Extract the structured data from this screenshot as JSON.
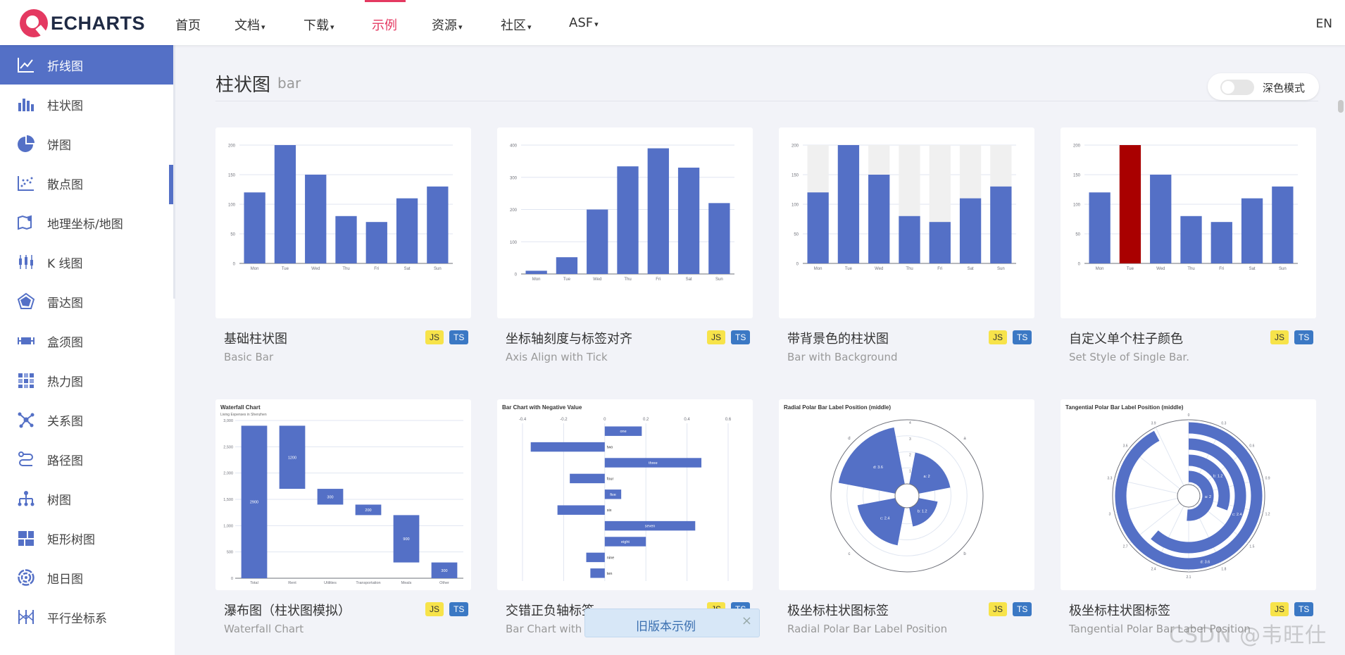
{
  "nav": {
    "logo_text": "ECHARTS",
    "items": [
      {
        "label": "首页",
        "caret": ""
      },
      {
        "label": "文档",
        "caret": "▾"
      },
      {
        "label": "下载",
        "caret": "▾"
      },
      {
        "label": "示例",
        "caret": ""
      },
      {
        "label": "资源",
        "caret": "▾"
      },
      {
        "label": "社区",
        "caret": "▾"
      },
      {
        "label": "ASF",
        "caret": "▾"
      }
    ],
    "active": "示例",
    "lang": "EN"
  },
  "sidebar": {
    "items": [
      {
        "label": "折线图",
        "icon": "line-chart-icon",
        "active": true
      },
      {
        "label": "柱状图",
        "icon": "bar-chart-icon"
      },
      {
        "label": "饼图",
        "icon": "pie-chart-icon"
      },
      {
        "label": "散点图",
        "icon": "scatter-chart-icon"
      },
      {
        "label": "地理坐标/地图",
        "icon": "map-icon"
      },
      {
        "label": "K 线图",
        "icon": "candlestick-icon"
      },
      {
        "label": "雷达图",
        "icon": "radar-icon"
      },
      {
        "label": "盒须图",
        "icon": "boxplot-icon"
      },
      {
        "label": "热力图",
        "icon": "heatmap-icon"
      },
      {
        "label": "关系图",
        "icon": "graph-icon"
      },
      {
        "label": "路径图",
        "icon": "lines-icon"
      },
      {
        "label": "树图",
        "icon": "tree-icon"
      },
      {
        "label": "矩形树图",
        "icon": "treemap-icon"
      },
      {
        "label": "旭日图",
        "icon": "sunburst-icon"
      },
      {
        "label": "平行坐标系",
        "icon": "parallel-icon"
      }
    ]
  },
  "header": {
    "title": "柱状图",
    "subtitle": "bar",
    "dark_mode_label": "深色模式",
    "dark_mode_on": false
  },
  "cards": [
    {
      "title": "基础柱状图",
      "subtitle": "Basic Bar",
      "js": "JS",
      "ts": "TS"
    },
    {
      "title": "坐标轴刻度与标签对齐",
      "subtitle": "Axis Align with Tick",
      "js": "JS",
      "ts": "TS"
    },
    {
      "title": "带背景色的柱状图",
      "subtitle": "Bar with Background",
      "js": "JS",
      "ts": "TS"
    },
    {
      "title": "自定义单个柱子颜色",
      "subtitle": "Set Style of Single Bar.",
      "js": "JS",
      "ts": "TS"
    },
    {
      "title": "瀑布图（柱状图模拟）",
      "subtitle": "Waterfall Chart",
      "js": "JS",
      "ts": "TS"
    },
    {
      "title": "交错正负轴标签",
      "subtitle": "Bar Chart with Negative Value",
      "js": "JS",
      "ts": "TS"
    },
    {
      "title": "极坐标柱状图标签",
      "subtitle": "Radial Polar Bar Label Position",
      "js": "JS",
      "ts": "TS"
    },
    {
      "title": "极坐标柱状图标签",
      "subtitle": "Tangential Polar Bar Label Position",
      "js": "JS",
      "ts": "TS"
    }
  ],
  "toast": {
    "label": "旧版本示例",
    "close": "×"
  },
  "watermark": "CSDN @韦旺仕",
  "colors": {
    "accent": "#5470c6",
    "brand": "#e43961",
    "highlight": "#a90000"
  },
  "chart_data": [
    {
      "type": "bar",
      "categories": [
        "Mon",
        "Tue",
        "Wed",
        "Thu",
        "Fri",
        "Sat",
        "Sun"
      ],
      "values": [
        120,
        200,
        150,
        80,
        70,
        110,
        130
      ],
      "ylim": [
        0,
        200
      ],
      "yticks": [
        "0",
        "50",
        "100",
        "150",
        "200"
      ]
    },
    {
      "type": "bar",
      "categories": [
        "Mon",
        "Tue",
        "Wed",
        "Thu",
        "Fri",
        "Sat",
        "Sun"
      ],
      "values": [
        10,
        52,
        200,
        334,
        390,
        330,
        220
      ],
      "ylim": [
        0,
        400
      ],
      "yticks": [
        "0",
        "100",
        "200",
        "300",
        "400"
      ]
    },
    {
      "type": "bar",
      "categories": [
        "Mon",
        "Tue",
        "Wed",
        "Thu",
        "Fri",
        "Sat",
        "Sun"
      ],
      "values": [
        120,
        200,
        150,
        80,
        70,
        110,
        130
      ],
      "ylim": [
        0,
        200
      ],
      "yticks": [
        "0",
        "50",
        "100",
        "150",
        "200"
      ],
      "background_bars": true
    },
    {
      "type": "bar",
      "categories": [
        "Mon",
        "Tue",
        "Wed",
        "Thu",
        "Fri",
        "Sat",
        "Sun"
      ],
      "values": [
        120,
        200,
        150,
        80,
        70,
        110,
        130
      ],
      "ylim": [
        0,
        200
      ],
      "yticks": [
        "0",
        "50",
        "100",
        "150",
        "200"
      ],
      "highlight_index": 1
    },
    {
      "type": "bar",
      "title": "Waterfall Chart",
      "subtitle": "Living Expenses in Shenzhen",
      "categories": [
        "Total",
        "Rent",
        "Utilities",
        "Transportation",
        "Meals",
        "Other"
      ],
      "values": [
        2900,
        1200,
        300,
        200,
        900,
        300
      ],
      "base": [
        0,
        1700,
        1400,
        1200,
        300,
        0
      ],
      "ylim": [
        0,
        3000
      ],
      "yticks": [
        "0",
        "500",
        "1,000",
        "1,500",
        "2,000",
        "2,500",
        "3,000"
      ]
    },
    {
      "type": "bar",
      "title": "Bar Chart with Negative Value",
      "categories": [
        "ten",
        "nine",
        "eight",
        "seven",
        "six",
        "five",
        "four",
        "three",
        "two",
        "one"
      ],
      "values": [
        -0.07,
        -0.09,
        0.2,
        0.44,
        -0.23,
        0.08,
        -0.17,
        0.47,
        -0.36,
        0.18
      ],
      "xlim": [
        -0.4,
        0.6
      ],
      "xticks": [
        "-0.4",
        "-0.2",
        "0",
        "0.2",
        "0.4",
        "0.6"
      ],
      "orientation": "horizontal"
    },
    {
      "type": "bar",
      "title": "Radial Polar Bar Label Position (middle)",
      "categories": [
        "a",
        "b",
        "c",
        "d"
      ],
      "values": [
        2,
        1.2,
        2.4,
        3.6
      ],
      "labels": [
        "a: 2",
        "b: 1.2",
        "c: 2.4",
        "d: 3.6"
      ],
      "radius_ticks": [
        "0",
        "1",
        "2",
        "3",
        "4"
      ]
    },
    {
      "type": "bar",
      "title": "Tangential Polar Bar Label Position (middle)",
      "categories": [
        "a",
        "b",
        "c",
        "d"
      ],
      "values": [
        2,
        1.2,
        2.4,
        3.6
      ],
      "labels": [
        "a: 2",
        "b: 1.2",
        "c: 2.4",
        "d: 3.6"
      ],
      "angle_ticks": [
        "0",
        "0.3",
        "0.6",
        "0.9",
        "1.2",
        "1.5",
        "1.8",
        "2.1",
        "2.4",
        "2.7",
        "3",
        "3.3",
        "3.6",
        "3.9"
      ]
    }
  ]
}
